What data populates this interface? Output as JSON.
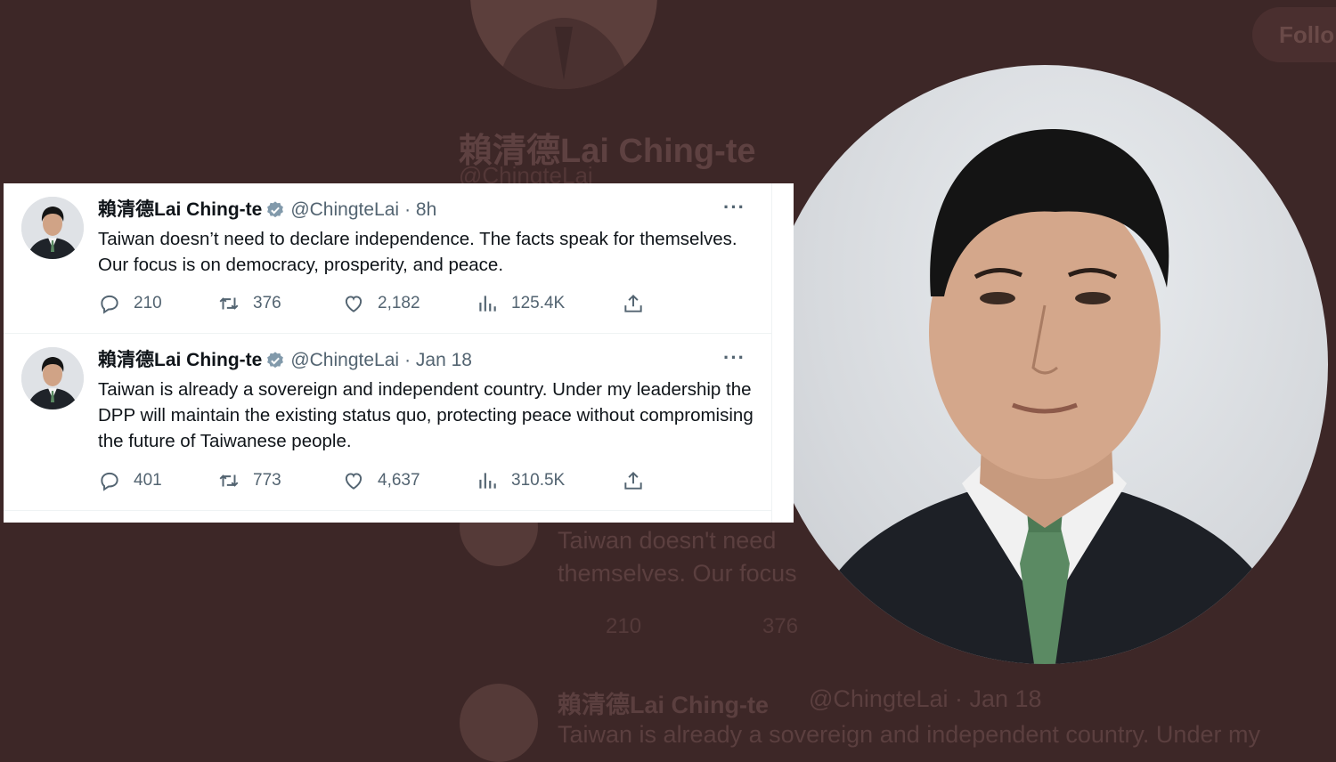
{
  "background": {
    "follow_label": "Follo",
    "profile_name": "賴清德Lai Ching-te",
    "profile_handle": "@ChingteLai",
    "faded_tweet_1_line1": "Taiwan doesn't need",
    "faded_tweet_1_line2": "themselves. Our focus",
    "faded_tweet_1_replies": "210",
    "faded_tweet_1_retweets": "376",
    "faded_tweet_2_name": "賴清德Lai Ching-te",
    "faded_tweet_2_handle": "@ChingteLai · Jan 18",
    "faded_tweet_2_line1": "Taiwan is already a sovereign and independent country. Under my"
  },
  "tweets": [
    {
      "name": "賴清德Lai Ching-te",
      "handle": "@ChingteLai",
      "time": "· 8h",
      "more": "···",
      "text": "Taiwan doesn’t need to declare independence. The facts speak for themselves. Our focus is on democracy, prosperity, and peace.",
      "replies": "210",
      "retweets": "376",
      "likes": "2,182",
      "views": "125.4K"
    },
    {
      "name": "賴清德Lai Ching-te",
      "handle": "@ChingteLai",
      "time": "· Jan 18",
      "more": "···",
      "text": "Taiwan is already a sovereign and independent country. Under my leadership the DPP will maintain the existing status quo, protecting peace without compromising the future of Taiwanese people.",
      "replies": "401",
      "retweets": "773",
      "likes": "4,637",
      "views": "310.5K"
    }
  ],
  "icons": [
    "reply-icon",
    "retweet-icon",
    "like-icon",
    "views-icon",
    "share-icon",
    "verified-badge-icon",
    "more-icon"
  ],
  "colors": {
    "accent_verified": "#1d9bf0",
    "text_primary": "#0f1419",
    "text_secondary": "#536471",
    "background": "#3d2727"
  }
}
